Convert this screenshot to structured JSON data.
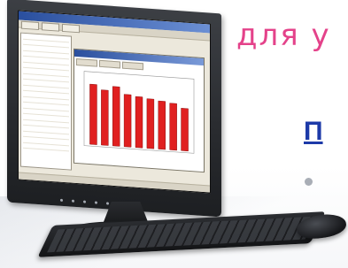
{
  "headline": "для у",
  "link_fragment": "П",
  "colors": {
    "headline": "#e4428a",
    "link": "#1d3aa8",
    "bar": "#e02020"
  },
  "chart_data": {
    "type": "bar",
    "values": [
      0.85,
      0.78,
      0.84,
      0.74,
      0.72,
      0.7,
      0.68,
      0.66,
      0.6
    ],
    "ylim": [
      0,
      1
    ]
  }
}
